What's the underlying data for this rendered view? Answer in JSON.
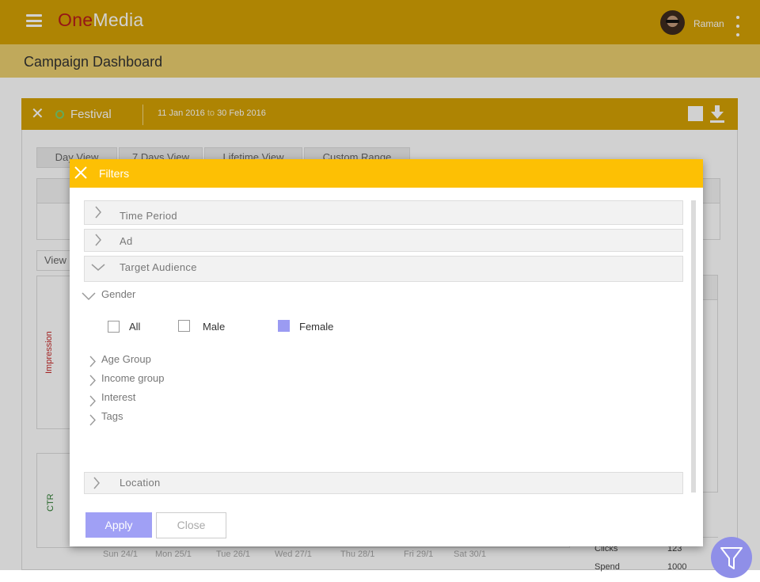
{
  "app": {
    "brand_part1": "One",
    "brand_part2": "Media",
    "user_name": "Raman",
    "page_title": "Campaign Dashboard"
  },
  "campaign": {
    "name": "Festival",
    "date_from": "11 Jan 2016",
    "date_sep": "to",
    "date_to": "30 Feb 2016"
  },
  "tabs": [
    "Day View",
    "7 Days View",
    "Lifetime View",
    "Custom Range"
  ],
  "background": {
    "view_label": "View",
    "impression_label": "Impression",
    "ctr_label": "CTR",
    "dates": [
      "Sun 24/1",
      "Mon 25/1",
      "Tue 26/1",
      "Wed 27/1",
      "Thu 28/1",
      "Fri 29/1",
      "Sat 30/1"
    ],
    "stats": [
      {
        "label": "Clicks",
        "value": "123"
      },
      {
        "label": "Spend",
        "value": "1000"
      }
    ]
  },
  "filters": {
    "title": "Filters",
    "sections": {
      "time_period": "Time Period",
      "ad": "Ad",
      "target_audience": "Target Audience",
      "location": "Location"
    },
    "gender": {
      "label": "Gender",
      "options": [
        {
          "label": "All",
          "checked": false
        },
        {
          "label": "Male",
          "checked": false
        },
        {
          "label": "Female",
          "checked": true
        }
      ]
    },
    "sub_groups": [
      "Age Group",
      "Income group",
      "Interest",
      "Tags"
    ],
    "apply_label": "Apply",
    "close_label": "Close"
  },
  "colors": {
    "header": "#d5a204",
    "modal_header": "#fdc004",
    "accent": "#9b9bf2",
    "brand_red": "#b71c1c"
  }
}
